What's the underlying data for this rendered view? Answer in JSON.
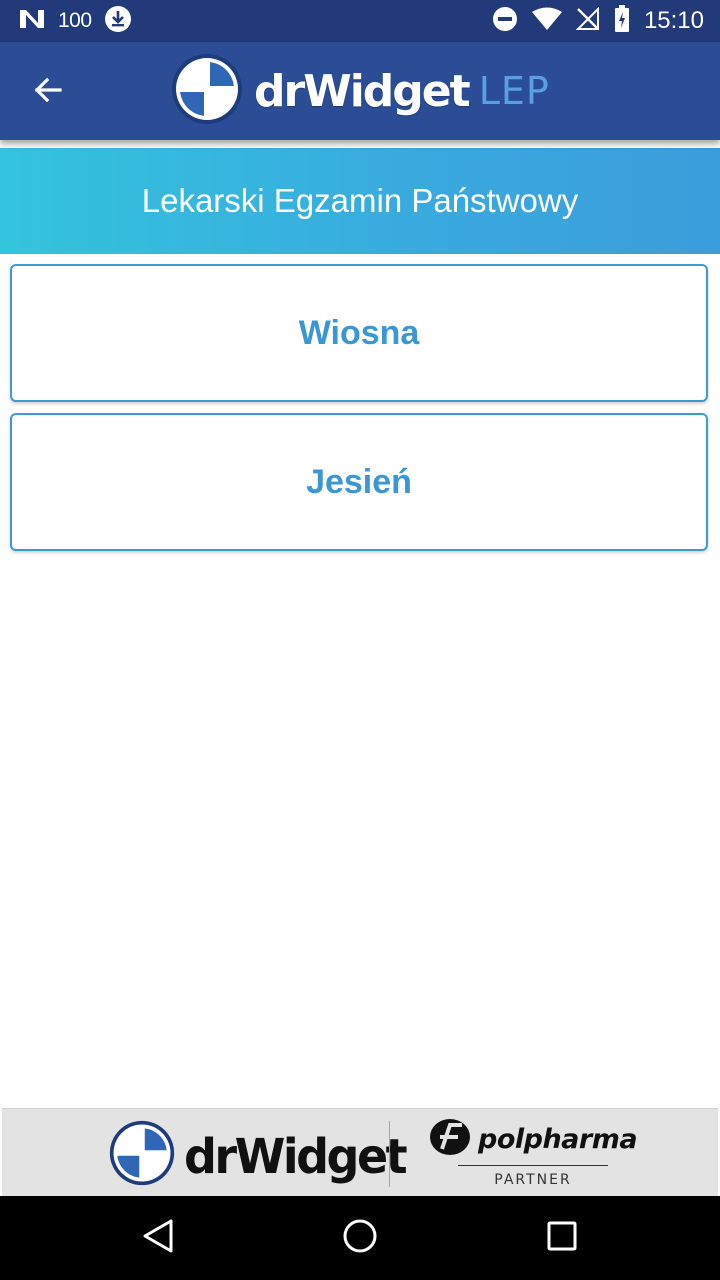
{
  "status_bar": {
    "battery_percent_label": "100",
    "time": "15:10",
    "icons": [
      "notification-n-icon",
      "download-icon",
      "do-not-disturb-icon",
      "wifi-icon",
      "no-signal-icon",
      "battery-icon"
    ]
  },
  "app_bar": {
    "logo_text": "drWidget",
    "logo_suffix": "LEP",
    "back_icon": "arrow-left-icon",
    "color": "#2b4d95"
  },
  "header": {
    "title": "Lekarski Egzamin Państwowy"
  },
  "options": [
    {
      "label": "Wiosna"
    },
    {
      "label": "Jesień"
    }
  ],
  "footer": {
    "logo_text": "drWidget",
    "partner_name": "polpharma",
    "partner_tag": "PARTNER"
  },
  "nav_bar": {
    "buttons": [
      "back-triangle-icon",
      "home-circle-icon",
      "recents-square-icon"
    ]
  },
  "colors": {
    "status_bar": "#22397a",
    "accent": "#3b97d3",
    "header_gradient_start": "#33c4dd",
    "header_gradient_end": "#3b9ddc"
  }
}
